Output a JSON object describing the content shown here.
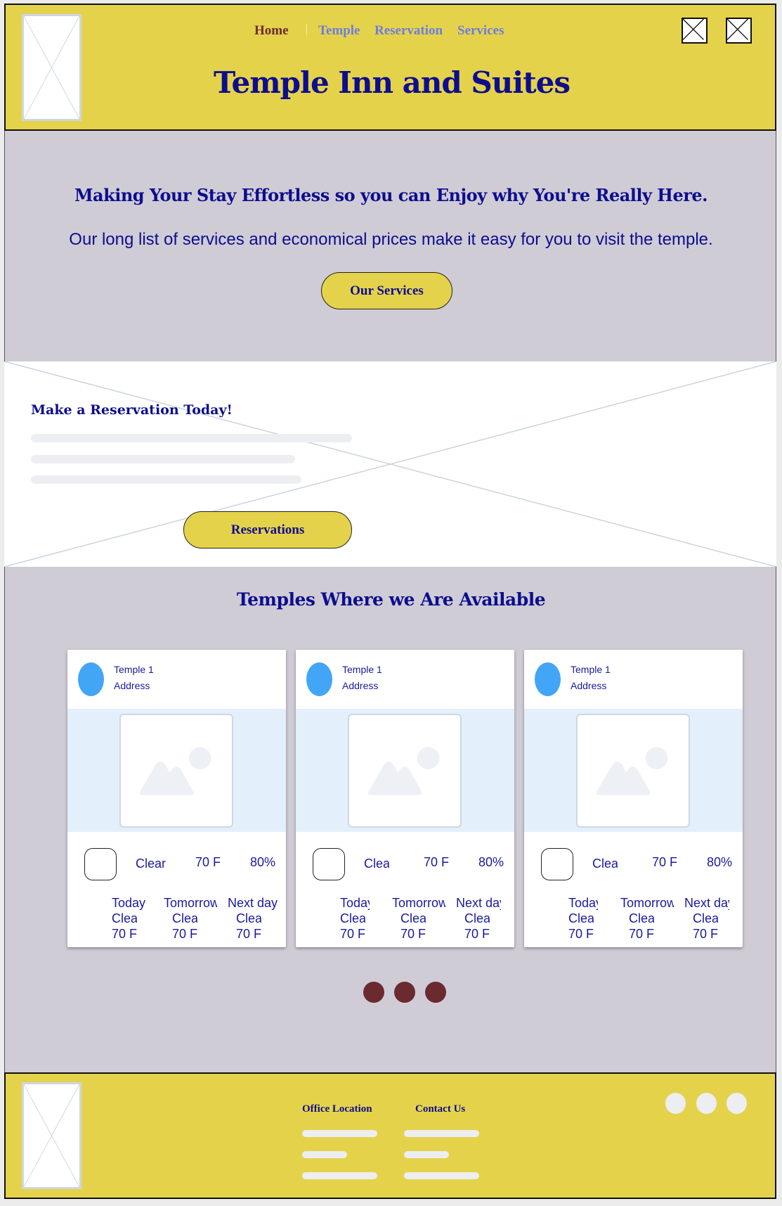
{
  "header": {
    "nav": [
      {
        "label": "Home",
        "active": true
      },
      {
        "label": "Temple"
      },
      {
        "label": "Reservation"
      },
      {
        "label": "Services"
      }
    ],
    "title": "Temple Inn and Suites"
  },
  "hero": {
    "heading": "Making Your Stay Effortless so you can Enjoy why You're Really Here.",
    "text": "Our long list of services and economical prices make it easy for you to visit the temple.",
    "button": "Our Services"
  },
  "reservation": {
    "heading": "Make a Reservation Today!",
    "button": "Reservations"
  },
  "temples": {
    "heading": "Temples Where we Are Available",
    "cards": [
      {
        "name": "Temple 1",
        "address": "Address",
        "condition": "Clear",
        "temp": "70 F",
        "humidity": "80%",
        "forecast": [
          {
            "day": "Today",
            "cond": "Clear",
            "temp": "70 F"
          },
          {
            "day": "Tomorrow",
            "cond": "Clear",
            "temp": "70 F"
          },
          {
            "day": "Next day",
            "cond": "Clear",
            "temp": "70 F"
          }
        ]
      },
      {
        "name": "Temple 1",
        "address": "Address",
        "condition": "Clear",
        "temp": "70 F",
        "humidity": "80%",
        "forecast": [
          {
            "day": "Today",
            "cond": "Clear",
            "temp": "70 F"
          },
          {
            "day": "Tomorrow",
            "cond": "Clear",
            "temp": "70 F"
          },
          {
            "day": "Next day",
            "cond": "Clear",
            "temp": "70 F"
          }
        ]
      },
      {
        "name": "Temple 1",
        "address": "Address",
        "condition": "Clear",
        "temp": "70 F",
        "humidity": "80%",
        "forecast": [
          {
            "day": "Today",
            "cond": "Clear",
            "temp": "70 F"
          },
          {
            "day": "Tomorrow",
            "cond": "Clear",
            "temp": "70 F"
          },
          {
            "day": "Next day",
            "cond": "Clear",
            "temp": "70 F"
          }
        ]
      }
    ]
  },
  "footer": {
    "office_heading": "Office Location",
    "contact_heading": "Contact Us"
  },
  "colors": {
    "brand_yellow": "#e5d24b",
    "navy": "#0d0d8e",
    "section_gray": "#cfccd6",
    "maroon": "#6b2a30",
    "link": "#6c7de0"
  }
}
